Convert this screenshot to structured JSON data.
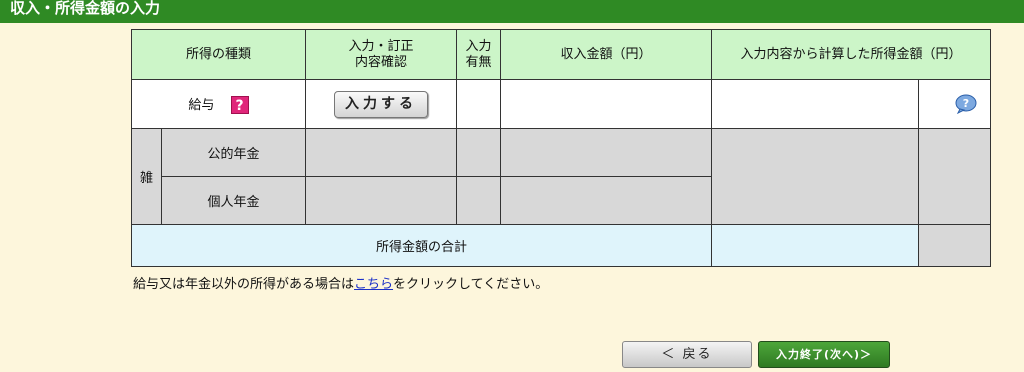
{
  "header": {
    "title": "収入・所得金額の入力"
  },
  "table": {
    "headers": {
      "type": "所得の種類",
      "confirm_line1": "入力・訂正",
      "confirm_line2": "内容確認",
      "presence_line1": "入力",
      "presence_line2": "有無",
      "income_amount": "収入金額（円）",
      "computed_amount": "入力内容から計算した所得金額（円）"
    },
    "rows": {
      "salary": {
        "label": "給与",
        "help_glyph": "?",
        "button": "入力する"
      },
      "misc_group": "雑",
      "public_pension": "公的年金",
      "private_pension": "個人年金",
      "total": "所得金額の合計"
    }
  },
  "note": {
    "before": "給与又は年金以外の所得がある場合は",
    "link": "こちら",
    "after": "をクリックしてください。"
  },
  "footer": {
    "back_button": "＜ 戻る",
    "finish_button": "入力終了(次へ)＞"
  },
  "colors": {
    "header_bar": "#2f8a24",
    "header_cells": "#ccf5c8",
    "disabled_cells": "#d8d8d8",
    "total_row": "#dff4fb",
    "help_icon": "#e0267a",
    "finish_button": "#3a8f2c"
  },
  "icons": {
    "salary_help": "help-question-icon",
    "computed_help": "help-bubble-icon"
  }
}
